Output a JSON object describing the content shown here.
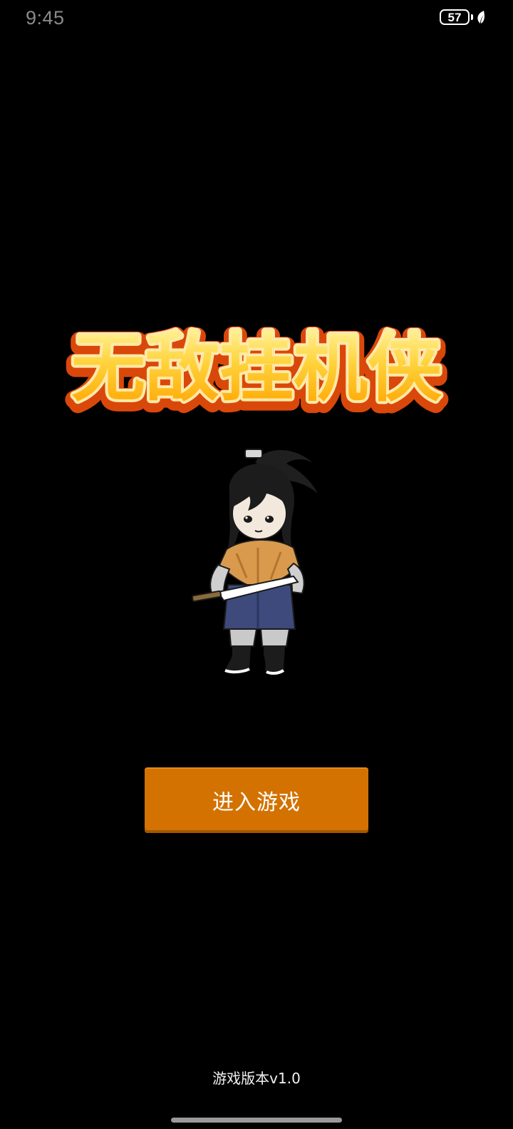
{
  "status_bar": {
    "time": "9:45",
    "battery_level": "57",
    "battery_icon": "battery-icon",
    "saver_icon": "leaf-icon"
  },
  "game": {
    "title": "无敌挂机侠",
    "title_colors": {
      "fill_top": "#fff27a",
      "fill_bottom": "#ffb100",
      "outline": "#e0520a"
    },
    "character_icon": "swordsman-character"
  },
  "actions": {
    "enter_label": "进入游戏",
    "enter_color": "#d37201"
  },
  "footer": {
    "version_label": "游戏版本v1.0"
  }
}
